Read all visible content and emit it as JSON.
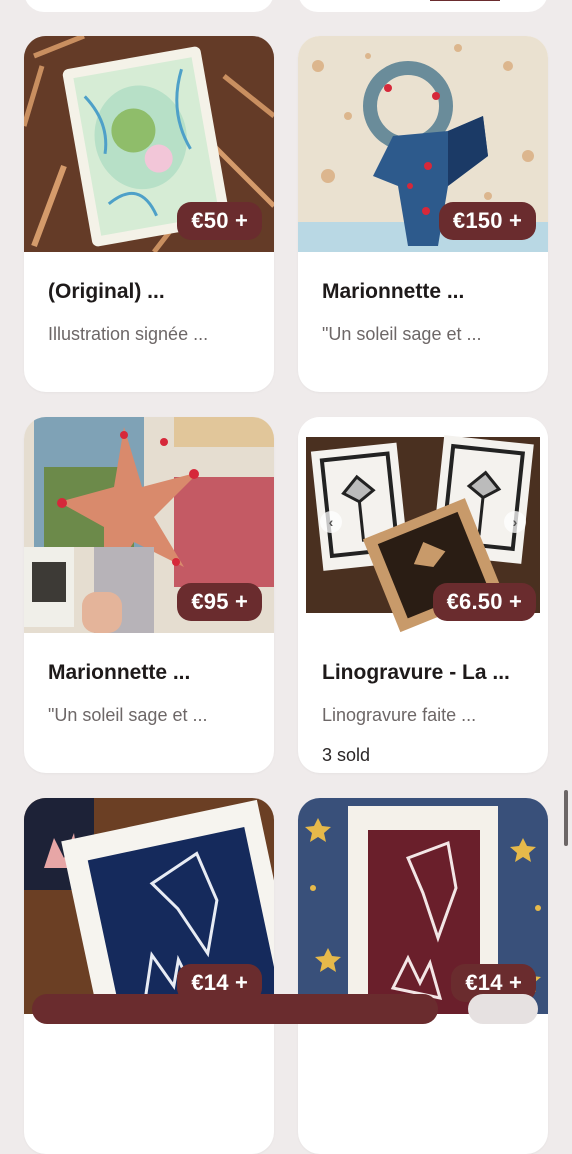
{
  "colors": {
    "background": "#efebeb",
    "card": "#ffffff",
    "price_badge": "#6a2c2e",
    "title_text": "#1e1a1a",
    "desc_text": "#6d6767"
  },
  "products": [
    {
      "price": "€50 +",
      "title": "(Original) ...",
      "description": "Illustration signée ...",
      "image_icon": "watercolor-lotus-card-image"
    },
    {
      "price": "€150 +",
      "title": "Marionnette ...",
      "description": "\"Un soleil sage et ...",
      "image_icon": "blue-moon-puppet-image"
    },
    {
      "price": "€95 +",
      "title": "Marionnette ...",
      "description": "\"Un soleil sage et ...",
      "image_icon": "starfish-puppet-image"
    },
    {
      "price": "€6.50 +",
      "title": "Linogravure - La ...",
      "description": "Linogravure faite ...",
      "sold": "3 sold",
      "image_icon": "linocut-butterfly-image"
    },
    {
      "price": "€14 +",
      "title": "",
      "description": "",
      "image_icon": "linocut-blue-print-image"
    },
    {
      "price": "€14 +",
      "title": "",
      "description": "",
      "image_icon": "linocut-red-print-image"
    }
  ],
  "carousel": {
    "prev_icon": "chevron-left-icon",
    "next_icon": "chevron-right-icon",
    "prev_glyph": "‹",
    "next_glyph": "›"
  }
}
